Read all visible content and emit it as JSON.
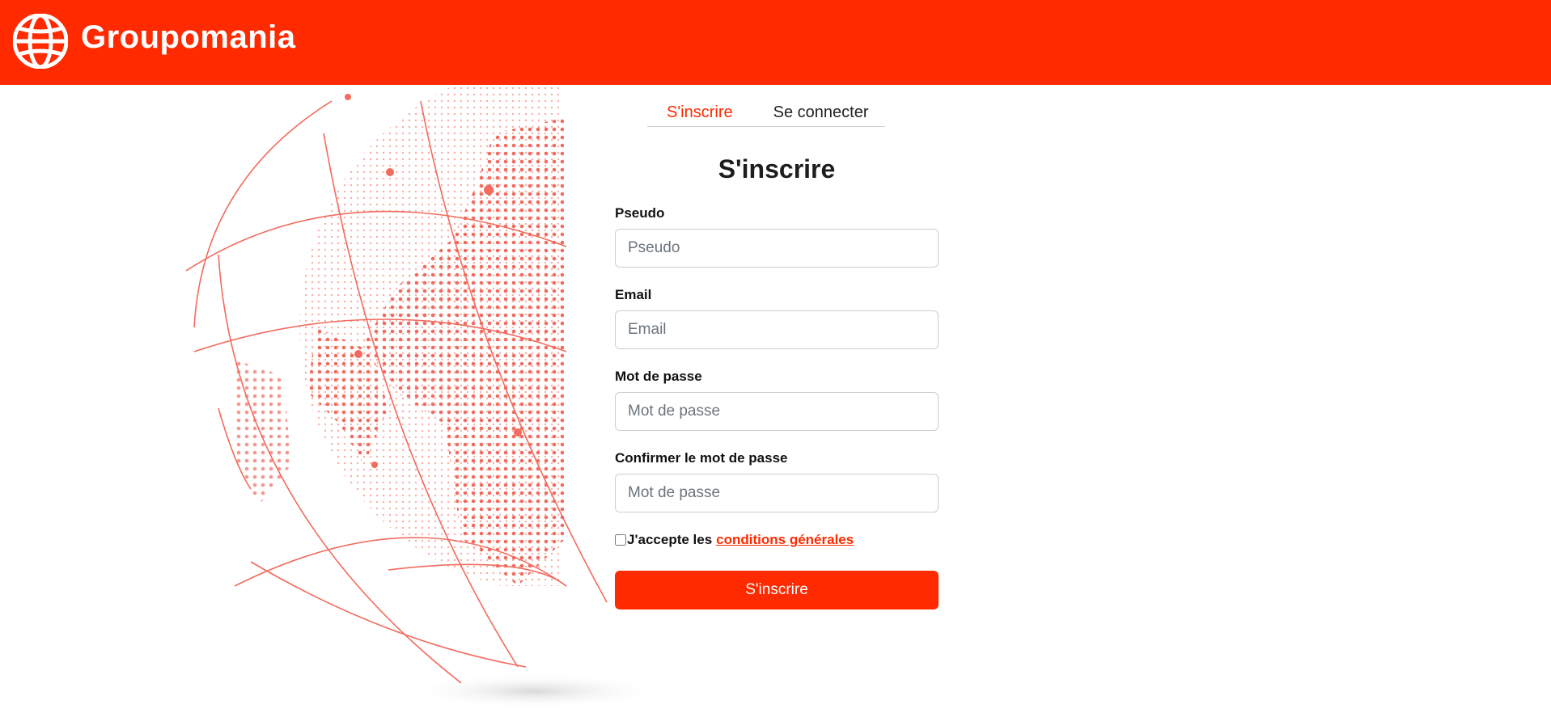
{
  "header": {
    "brand": "Groupomania",
    "logo_icon": "globe-icon",
    "background_color": "#ff2a00"
  },
  "tabs": [
    {
      "label": "S'inscrire",
      "active": true
    },
    {
      "label": "Se connecter",
      "active": false
    }
  ],
  "form": {
    "title": "S'inscrire",
    "fields": [
      {
        "label": "Pseudo",
        "placeholder": "Pseudo",
        "value": ""
      },
      {
        "label": "Email",
        "placeholder": "Email",
        "value": ""
      },
      {
        "label": "Mot de passe",
        "placeholder": "Mot de passe",
        "value": ""
      },
      {
        "label": "Confirmer le mot de passe",
        "placeholder": "Mot de passe",
        "value": ""
      }
    ],
    "terms": {
      "prefix": "J'accepte les",
      "link": "conditions générales",
      "checked": false
    },
    "submit_label": "S'inscrire"
  },
  "colors": {
    "accent": "#ff2a00",
    "globe": "#f26b5e"
  }
}
